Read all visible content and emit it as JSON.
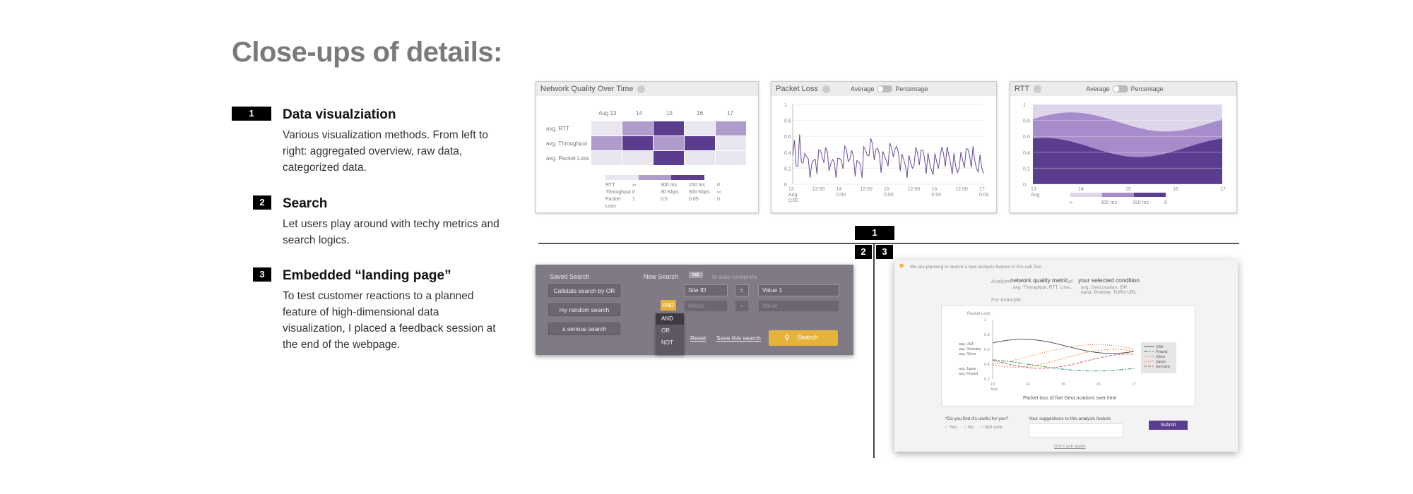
{
  "title": "Close-ups of details:",
  "sections": [
    {
      "number": "1",
      "heading": "Data visualziation",
      "body": "Various visualization methods. From left to right: aggregated overview, raw data, categorized data."
    },
    {
      "number": "2",
      "heading": "Search",
      "body": "Let users play around with techy metrics and search logics."
    },
    {
      "number": "3",
      "heading": "Embedded “landing page”",
      "body": "To test customer reactions to a planned feature of high-dimensional data visualization, I placed a feedback session at the end of the webpage."
    }
  ],
  "markers": {
    "one": "1",
    "two": "2",
    "three": "3"
  },
  "heatmap": {
    "title": "Network Quality Over Time",
    "dates": [
      "Aug 13",
      "14",
      "15",
      "16",
      "17"
    ],
    "rows": [
      "avg. RTT",
      "avg. Throughput",
      "avg. Packet Loss"
    ],
    "levels": [
      [
        0,
        1,
        3,
        0,
        1
      ],
      [
        1,
        3,
        1,
        3,
        0
      ],
      [
        0,
        0,
        3,
        0,
        0
      ]
    ],
    "legend": {
      "metrics": [
        "RTT",
        "Throughput",
        "Packet Loss"
      ],
      "values": [
        [
          "∞",
          "300 ms",
          "150 ms",
          "0"
        ],
        [
          "0",
          "30 Kbps",
          "300 Kbps",
          "∞"
        ],
        [
          "1",
          "0.5",
          "0.05",
          "0"
        ]
      ]
    },
    "colors": [
      "#e9e6ef",
      "#b09ccc",
      "#8a6bb5",
      "#5b3d8f"
    ]
  },
  "packet_loss": {
    "title": "Packet Loss",
    "toggle_left": "Average",
    "toggle_right": "Percentage",
    "y_ticks": [
      "1",
      "0.8",
      "0.6",
      "0.4",
      "0.2",
      "0"
    ],
    "x_ticks": [
      [
        "13",
        "Aug",
        "0:00"
      ],
      [
        "12:00"
      ],
      [
        "14",
        "0:00"
      ],
      [
        "12:00"
      ],
      [
        "15",
        "0:00"
      ],
      [
        "12:00"
      ],
      [
        "16",
        "0:00"
      ],
      [
        "12:00"
      ],
      [
        "17",
        "0:00"
      ]
    ],
    "line_color": "#6a4a9c"
  },
  "rtt": {
    "title": "RTT",
    "toggle_left": "Average",
    "toggle_right": "Percentage",
    "y_ticks": [
      "1",
      "0.8",
      "0.6",
      "0.4",
      "0.2",
      "0"
    ],
    "x_ticks": [
      [
        "13",
        "Aug"
      ],
      [
        "14"
      ],
      [
        "15"
      ],
      [
        "16"
      ],
      [
        "17"
      ]
    ],
    "legend_values": [
      "∞",
      "300 ms",
      "150 ms",
      "0"
    ],
    "colors": [
      "#ddd6ea",
      "#a68ccb",
      "#5b3d8f"
    ]
  },
  "search": {
    "saved_label": "Saved Search",
    "saved_items": [
      "Callstats search by OR",
      "my random search",
      "a serious search"
    ],
    "new_label": "New Search",
    "tab_key": "tab",
    "autocomplete": "to auto-complete",
    "row1": {
      "field": "Site ID",
      "op": "=",
      "value": "Value 1"
    },
    "row2": {
      "field": "Metric",
      "op": "=",
      "value": "Value"
    },
    "logic_selected": "AND",
    "logic_options": [
      "AND",
      "OR",
      "NOT"
    ],
    "reset": "Reset",
    "save": "Save this search",
    "search_button": "Search",
    "accent": "#e5b33c"
  },
  "landing": {
    "notice": "We are planning to launch a new analysis feature in Pre-call Test",
    "analyze_label": "Analyze",
    "metric": "network quality metric",
    "metric_sub": "avg. Throughput, RTT, Loss...",
    "of": "of",
    "condition": "your selected condition",
    "condition_sub": "avg. GeoLocation, ISP, band, Provider, TURN URL",
    "for_example": "For example:",
    "chart": {
      "ylabel": "Packet Loss",
      "y_ticks": [
        "1",
        "0.8",
        "0.6",
        "0.4",
        "0.2"
      ],
      "x_ticks": [
        "13",
        "14",
        "15",
        "16",
        "17"
      ],
      "x_sub": "Aug",
      "caption": "Packet loss of five GeoLocations over time",
      "left_labels": [
        "avg. USA",
        "avg. Germany",
        "avg. China",
        "avg. Japan",
        "avg. Finland"
      ],
      "series": [
        {
          "name": "USA",
          "color": "#555555"
        },
        {
          "name": "Finland",
          "color": "#2a9a5a"
        },
        {
          "name": "China",
          "color": "#e08a3c"
        },
        {
          "name": "Japan",
          "color": "#e0642c"
        },
        {
          "name": "Germany",
          "color": "#d85a5a"
        }
      ]
    },
    "question": "*Do you find it's useful for you?",
    "options": [
      "Yes",
      "No",
      "Not sure"
    ],
    "suggest_label": "Your suggestions to this analysis feature",
    "submit": "Submit",
    "dont_ask": "Don't ask again",
    "submit_color": "#5b3d8f"
  }
}
